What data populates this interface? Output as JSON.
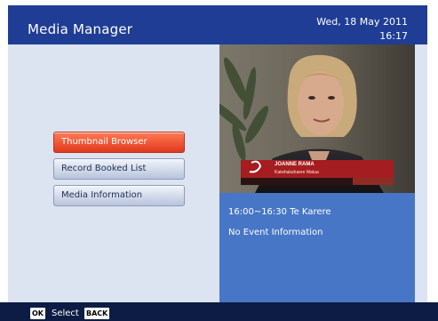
{
  "header": {
    "title": "Media Manager",
    "date": "Wed, 18 May 2011",
    "time": "16:17"
  },
  "menu": {
    "items": [
      {
        "label": "Thumbnail Browser",
        "selected": true
      },
      {
        "label": "Record Booked List",
        "selected": false
      },
      {
        "label": "Media Information",
        "selected": false
      }
    ]
  },
  "preview": {
    "caption_name": "JOANNE RAMA",
    "caption_sub": "Kaiwhakahaere Matua",
    "programme_time": "16:00~16:30  Te Karere",
    "programme_info": "No Event Information"
  },
  "footer": {
    "ok_key": "OK",
    "ok_label": "Select",
    "back_key": "BACK"
  },
  "colors": {
    "header_bg": "#1f3d94",
    "body_bg": "#dce3f1",
    "selected_item": "#e0391c",
    "preview_bg": "#4876c6",
    "footer_bg": "#0c1c44"
  }
}
